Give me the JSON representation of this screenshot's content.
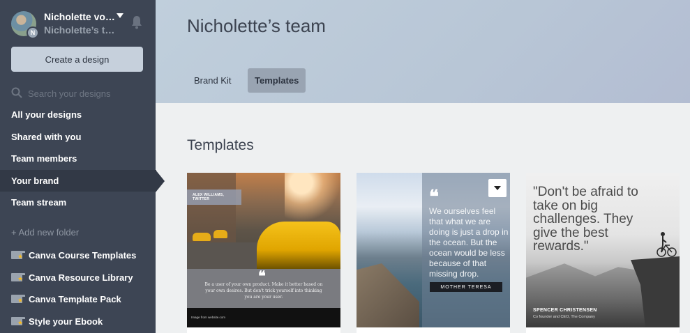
{
  "sidebar": {
    "user_name": "Nicholette von...",
    "user_team": "Nicholette’s te...",
    "team_badge": "N",
    "create_label": "Create a design",
    "search_placeholder": "Search your designs",
    "nav": [
      {
        "label": "All your designs"
      },
      {
        "label": "Shared with you"
      },
      {
        "label": "Team members"
      },
      {
        "label": "Your brand",
        "active": true
      },
      {
        "label": "Team stream"
      }
    ],
    "add_folder": "+ Add new folder",
    "folders": [
      {
        "label": "Canva Course Templates"
      },
      {
        "label": "Canva Resource Library"
      },
      {
        "label": "Canva Template Pack"
      },
      {
        "label": "Style your Ebook"
      }
    ]
  },
  "header": {
    "title": "Nicholette’s team",
    "tabs": [
      {
        "label": "Brand Kit",
        "active": false
      },
      {
        "label": "Templates",
        "active": true
      }
    ]
  },
  "main": {
    "section_title": "Templates",
    "cards": [
      {
        "label": "ALEX WILLIAMS, TWITTER",
        "quote_mark": "❝",
        "quote": "Be a user of your own product. Make it better based on your own desires. But don't trick yourself into thinking you are your user.",
        "footer": "Image from website.com"
      },
      {
        "quote_mark": "❝",
        "quote": "We ourselves feel that what we are doing is just a drop in the ocean. But the ocean would be less because of that missing drop.",
        "author": "MOTHER TERESA"
      },
      {
        "quote": "\"Don't be afraid to take on big challenges. They give the best rewards.\"",
        "name": "SPENCER CHRISTENSEN",
        "role": "Co founder and CEO, The Company"
      }
    ]
  },
  "colors": {
    "sidebar_bg": "#3d4554",
    "sidebar_active": "#323946",
    "header_bg": "#bccad9",
    "tab_active": "#99a4b2",
    "content_bg": "#eef0f1"
  }
}
